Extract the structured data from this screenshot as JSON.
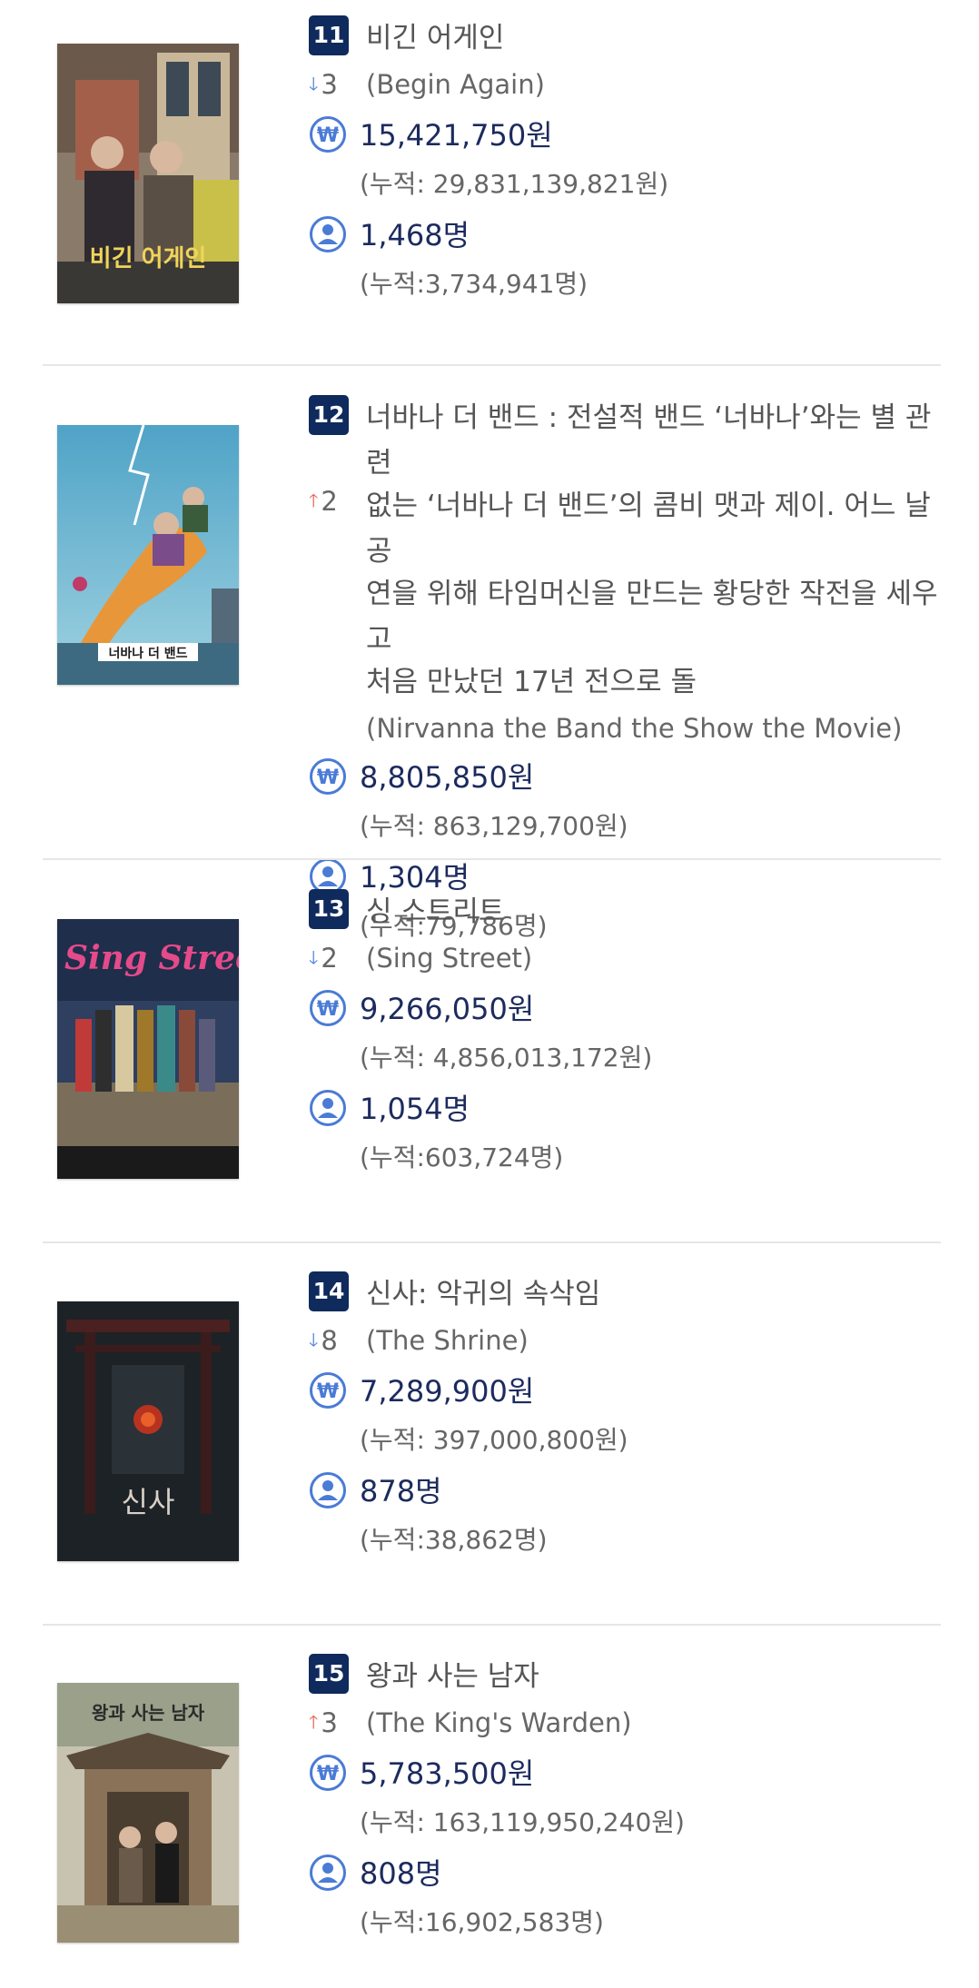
{
  "movies": [
    {
      "rank": "11",
      "title": "비긴 어게인",
      "change_dir": "down",
      "change": "3",
      "original_title": "(Begin Again)",
      "revenue": "15,421,750원",
      "revenue_cum": "(누적: 29,831,139,821원)",
      "audience": "1,468명",
      "audience_cum": "(누적:3,734,941명)",
      "poster_text": "비긴 어게인"
    },
    {
      "rank": "12",
      "title_lines": [
        "너바나 더 밴드 : 전설적 밴드 ‘너바나’와는 별 관련",
        "없는 ‘너바나 더 밴드’의 콤비 맷과 제이. 어느 날 공",
        "연을 위해 타임머신을 만드는 황당한 작전을 세우고",
        "처음 만났던 17년 전으로 돌"
      ],
      "change_dir": "up",
      "change": "2",
      "original_title": "(Nirvanna the Band the Show the Movie)",
      "revenue": "8,805,850원",
      "revenue_cum": "(누적: 863,129,700원)",
      "audience": "1,304명",
      "audience_cum": "(누적:79,786명)",
      "poster_text": "너바나 더 밴드"
    },
    {
      "rank": "13",
      "title": "싱 스트리트",
      "change_dir": "down",
      "change": "2",
      "original_title": "(Sing Street)",
      "revenue": "9,266,050원",
      "revenue_cum": "(누적: 4,856,013,172원)",
      "audience": "1,054명",
      "audience_cum": "(누적:603,724명)",
      "poster_text": "Sing Street"
    },
    {
      "rank": "14",
      "title": "신사: 악귀의 속삭임",
      "change_dir": "down",
      "change": "8",
      "original_title": "(The Shrine)",
      "revenue": "7,289,900원",
      "revenue_cum": "(누적: 397,000,800원)",
      "audience": "878명",
      "audience_cum": "(누적:38,862명)",
      "poster_text": "신사"
    },
    {
      "rank": "15",
      "title": "왕과 사는 남자",
      "change_dir": "up",
      "change": "3",
      "original_title": "(The King's Warden)",
      "revenue": "5,783,500원",
      "revenue_cum": "(누적: 163,119,950,240원)",
      "audience": "808명",
      "audience_cum": "(누적:16,902,583명)",
      "poster_text": "왕과 사는 남자"
    }
  ],
  "icons": {
    "revenue": "won-circle-icon",
    "audience": "person-circle-icon",
    "down": "arrow-down-icon",
    "up": "arrow-up-icon"
  },
  "colors": {
    "rank_badge": "#0f2a5c",
    "value_text": "#1c2b5e",
    "icon": "#4a7bd6",
    "arrow_up": "#e8604f",
    "arrow_down": "#4a7bd6"
  }
}
